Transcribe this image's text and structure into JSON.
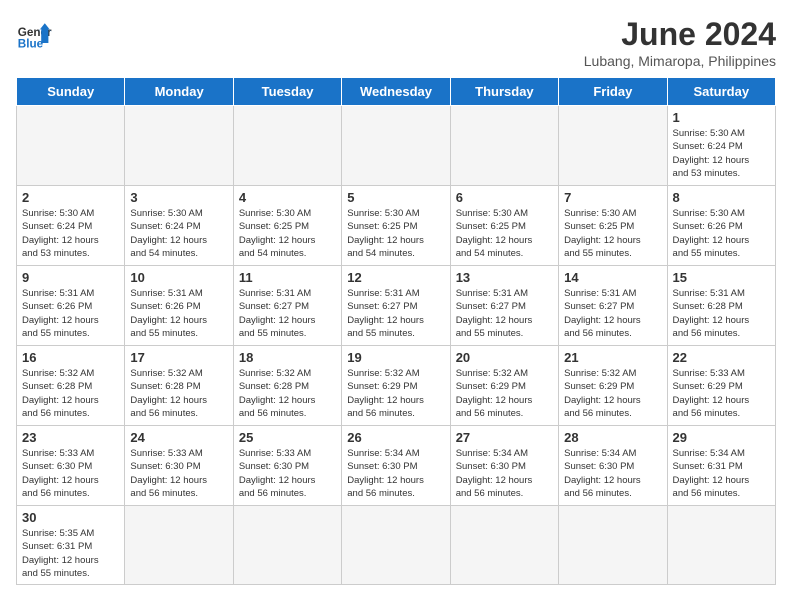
{
  "header": {
    "logo_general": "General",
    "logo_blue": "Blue",
    "title": "June 2024",
    "subtitle": "Lubang, Mimaropa, Philippines"
  },
  "days": [
    "Sunday",
    "Monday",
    "Tuesday",
    "Wednesday",
    "Thursday",
    "Friday",
    "Saturday"
  ],
  "weeks": [
    [
      {
        "date": "",
        "info": ""
      },
      {
        "date": "",
        "info": ""
      },
      {
        "date": "",
        "info": ""
      },
      {
        "date": "",
        "info": ""
      },
      {
        "date": "",
        "info": ""
      },
      {
        "date": "",
        "info": ""
      },
      {
        "date": "1",
        "info": "Sunrise: 5:30 AM\nSunset: 6:24 PM\nDaylight: 12 hours\nand 53 minutes."
      }
    ],
    [
      {
        "date": "2",
        "info": "Sunrise: 5:30 AM\nSunset: 6:24 PM\nDaylight: 12 hours\nand 53 minutes."
      },
      {
        "date": "3",
        "info": "Sunrise: 5:30 AM\nSunset: 6:24 PM\nDaylight: 12 hours\nand 54 minutes."
      },
      {
        "date": "4",
        "info": "Sunrise: 5:30 AM\nSunset: 6:25 PM\nDaylight: 12 hours\nand 54 minutes."
      },
      {
        "date": "5",
        "info": "Sunrise: 5:30 AM\nSunset: 6:25 PM\nDaylight: 12 hours\nand 54 minutes."
      },
      {
        "date": "6",
        "info": "Sunrise: 5:30 AM\nSunset: 6:25 PM\nDaylight: 12 hours\nand 54 minutes."
      },
      {
        "date": "7",
        "info": "Sunrise: 5:30 AM\nSunset: 6:25 PM\nDaylight: 12 hours\nand 55 minutes."
      },
      {
        "date": "8",
        "info": "Sunrise: 5:30 AM\nSunset: 6:26 PM\nDaylight: 12 hours\nand 55 minutes."
      }
    ],
    [
      {
        "date": "9",
        "info": "Sunrise: 5:31 AM\nSunset: 6:26 PM\nDaylight: 12 hours\nand 55 minutes."
      },
      {
        "date": "10",
        "info": "Sunrise: 5:31 AM\nSunset: 6:26 PM\nDaylight: 12 hours\nand 55 minutes."
      },
      {
        "date": "11",
        "info": "Sunrise: 5:31 AM\nSunset: 6:27 PM\nDaylight: 12 hours\nand 55 minutes."
      },
      {
        "date": "12",
        "info": "Sunrise: 5:31 AM\nSunset: 6:27 PM\nDaylight: 12 hours\nand 55 minutes."
      },
      {
        "date": "13",
        "info": "Sunrise: 5:31 AM\nSunset: 6:27 PM\nDaylight: 12 hours\nand 55 minutes."
      },
      {
        "date": "14",
        "info": "Sunrise: 5:31 AM\nSunset: 6:27 PM\nDaylight: 12 hours\nand 56 minutes."
      },
      {
        "date": "15",
        "info": "Sunrise: 5:31 AM\nSunset: 6:28 PM\nDaylight: 12 hours\nand 56 minutes."
      }
    ],
    [
      {
        "date": "16",
        "info": "Sunrise: 5:32 AM\nSunset: 6:28 PM\nDaylight: 12 hours\nand 56 minutes."
      },
      {
        "date": "17",
        "info": "Sunrise: 5:32 AM\nSunset: 6:28 PM\nDaylight: 12 hours\nand 56 minutes."
      },
      {
        "date": "18",
        "info": "Sunrise: 5:32 AM\nSunset: 6:28 PM\nDaylight: 12 hours\nand 56 minutes."
      },
      {
        "date": "19",
        "info": "Sunrise: 5:32 AM\nSunset: 6:29 PM\nDaylight: 12 hours\nand 56 minutes."
      },
      {
        "date": "20",
        "info": "Sunrise: 5:32 AM\nSunset: 6:29 PM\nDaylight: 12 hours\nand 56 minutes."
      },
      {
        "date": "21",
        "info": "Sunrise: 5:32 AM\nSunset: 6:29 PM\nDaylight: 12 hours\nand 56 minutes."
      },
      {
        "date": "22",
        "info": "Sunrise: 5:33 AM\nSunset: 6:29 PM\nDaylight: 12 hours\nand 56 minutes."
      }
    ],
    [
      {
        "date": "23",
        "info": "Sunrise: 5:33 AM\nSunset: 6:30 PM\nDaylight: 12 hours\nand 56 minutes."
      },
      {
        "date": "24",
        "info": "Sunrise: 5:33 AM\nSunset: 6:30 PM\nDaylight: 12 hours\nand 56 minutes."
      },
      {
        "date": "25",
        "info": "Sunrise: 5:33 AM\nSunset: 6:30 PM\nDaylight: 12 hours\nand 56 minutes."
      },
      {
        "date": "26",
        "info": "Sunrise: 5:34 AM\nSunset: 6:30 PM\nDaylight: 12 hours\nand 56 minutes."
      },
      {
        "date": "27",
        "info": "Sunrise: 5:34 AM\nSunset: 6:30 PM\nDaylight: 12 hours\nand 56 minutes."
      },
      {
        "date": "28",
        "info": "Sunrise: 5:34 AM\nSunset: 6:30 PM\nDaylight: 12 hours\nand 56 minutes."
      },
      {
        "date": "29",
        "info": "Sunrise: 5:34 AM\nSunset: 6:31 PM\nDaylight: 12 hours\nand 56 minutes."
      }
    ],
    [
      {
        "date": "30",
        "info": "Sunrise: 5:35 AM\nSunset: 6:31 PM\nDaylight: 12 hours\nand 55 minutes."
      },
      {
        "date": "",
        "info": ""
      },
      {
        "date": "",
        "info": ""
      },
      {
        "date": "",
        "info": ""
      },
      {
        "date": "",
        "info": ""
      },
      {
        "date": "",
        "info": ""
      },
      {
        "date": "",
        "info": ""
      }
    ]
  ]
}
